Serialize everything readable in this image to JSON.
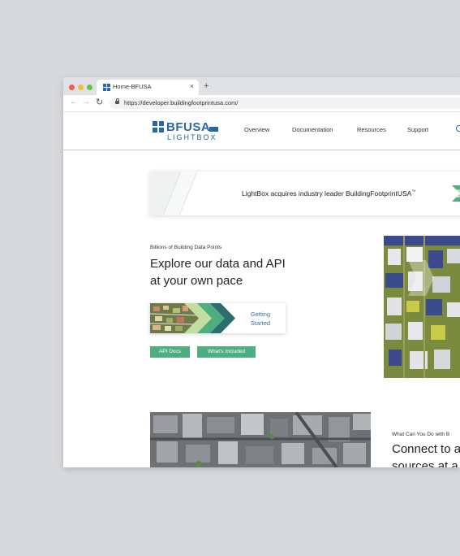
{
  "browser": {
    "tab_title": "Home-BFUSA",
    "tab_close": "×",
    "new_tab": "+",
    "url": "https://developer.buildingfootprintusa.com/"
  },
  "header": {
    "logo_main": "BFUSA",
    "logo_sub": "LIGHTBOX",
    "nav": [
      "Overview",
      "Documentation",
      "Resources",
      "Support"
    ]
  },
  "banner": {
    "text": "LightBox acquires industry leader BuildingFootprintUSA",
    "trademark": "™"
  },
  "hero": {
    "eyebrow": "Billions of Building Data Points",
    "heading_line1": "Explore our data and API",
    "heading_line2": "at your own pace",
    "card_label_line1": "Getting",
    "card_label_line2": "Started",
    "btn_api_docs": "API Docs",
    "btn_whats_included": "What's Included"
  },
  "section2": {
    "eyebrow": "What Can You Do with B",
    "heading_line1": "Connect to a",
    "heading_line2": "sources at a"
  },
  "colors": {
    "brand_blue": "#2766a8",
    "accent_green": "#4fae7f",
    "dark_teal": "#2a6e6e"
  }
}
